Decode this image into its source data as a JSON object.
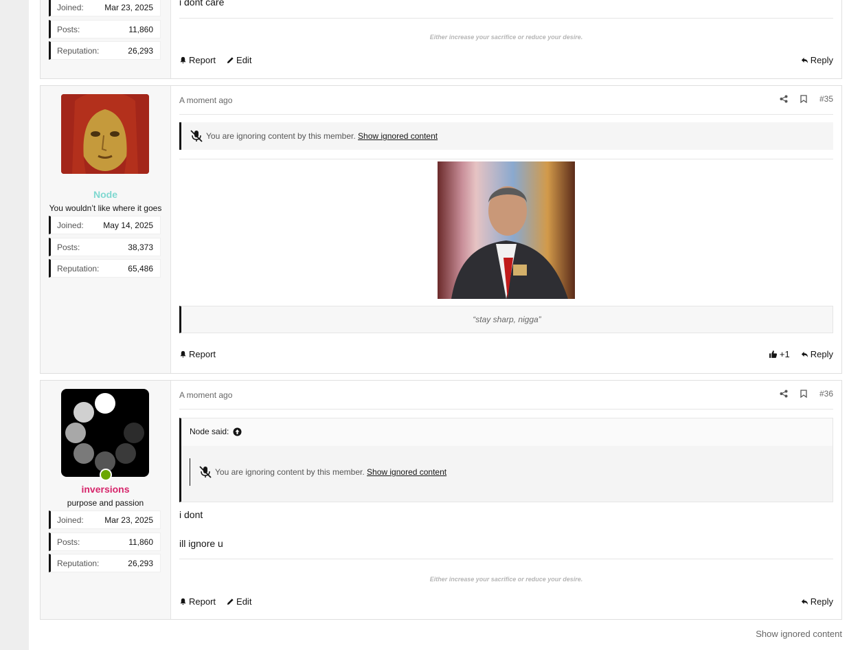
{
  "posts": [
    {
      "user": {
        "stats": [
          {
            "label": "Joined:",
            "value": "Mar 23, 2025"
          },
          {
            "label": "Posts:",
            "value": "11,860"
          },
          {
            "label": "Reputation:",
            "value": "26,293"
          }
        ]
      },
      "body_lines": [
        "i dont care"
      ],
      "signature": "Either increase your sacrifice or reduce your desire.",
      "footer": {
        "report": "Report",
        "edit": "Edit",
        "reply": "Reply"
      }
    },
    {
      "user": {
        "name": "Node",
        "title": "You wouldn’t like where it goes",
        "name_color": "#7fd8d0",
        "stats": [
          {
            "label": "Joined:",
            "value": "May 14, 2025"
          },
          {
            "label": "Posts:",
            "value": "38,373"
          },
          {
            "label": "Reputation:",
            "value": "65,486"
          }
        ]
      },
      "time": "A moment ago",
      "number": "#35",
      "ignore_text": "You are ignoring content by this member.",
      "ignore_link": "Show ignored content",
      "signature_quote": "“stay sharp, nigga”",
      "footer": {
        "report": "Report",
        "reply": "Reply",
        "reaction_count": "+1"
      }
    },
    {
      "user": {
        "name": "inversions",
        "title": "purpose and passion",
        "name_color": "#d6246a",
        "stats": [
          {
            "label": "Joined:",
            "value": "Mar 23, 2025"
          },
          {
            "label": "Posts:",
            "value": "11,860"
          },
          {
            "label": "Reputation:",
            "value": "26,293"
          }
        ]
      },
      "time": "A moment ago",
      "number": "#36",
      "quote_author": "Node said:",
      "ignore_text": "You are ignoring content by this member.",
      "ignore_link": "Show ignored content",
      "body_lines": [
        "i dont",
        "ill ignore u"
      ],
      "signature": "Either increase your sacrifice or reduce your desire.",
      "footer": {
        "report": "Report",
        "edit": "Edit",
        "reply": "Reply"
      }
    }
  ],
  "show_ignored": "Show ignored content",
  "colors": {
    "accent": "#141414",
    "online": "#6aa700"
  },
  "icons": [
    "share-icon",
    "bookmark-icon",
    "bell-icon",
    "pencil-icon",
    "reply-icon",
    "thumbs-up-icon",
    "mute-icon",
    "arrow-up-circle-icon"
  ]
}
